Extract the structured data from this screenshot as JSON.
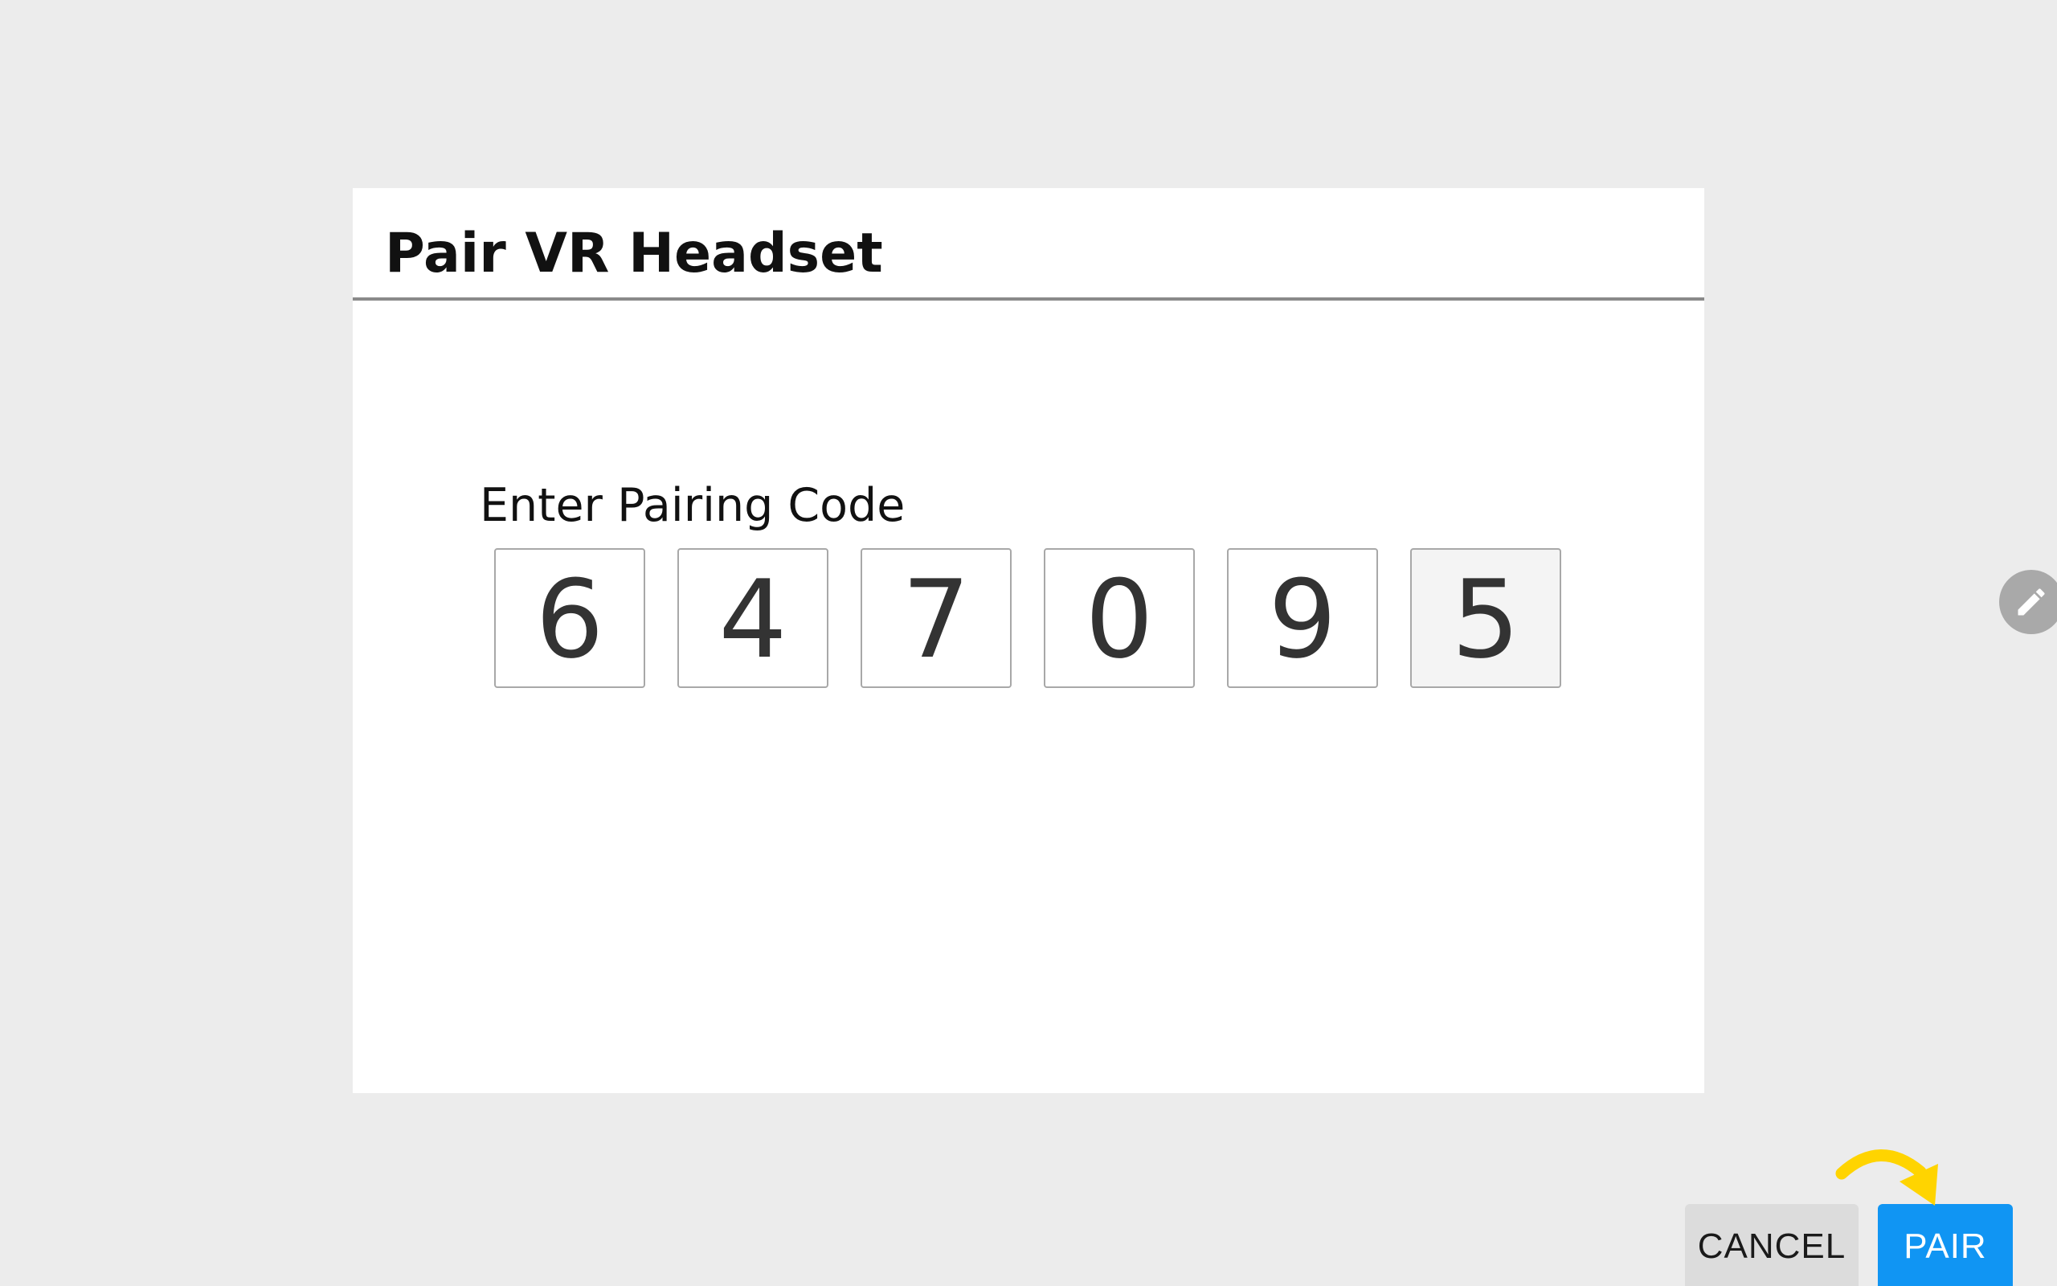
{
  "dialog": {
    "title": "Pair VR Headset",
    "label": "Enter Pairing Code",
    "code_digits": [
      "6",
      "4",
      "7",
      "0",
      "9",
      "5"
    ],
    "active_digit_index": 5
  },
  "buttons": {
    "cancel_label": "CANCEL",
    "pair_label": "PAIR"
  },
  "icons": {
    "edit": "pencil-icon",
    "hint": "curved-arrow-icon"
  },
  "colors": {
    "background": "#ececec",
    "dialog": "#ffffff",
    "primary": "#1095f3",
    "secondary_button": "#dcdcdc",
    "hint_arrow": "#ffd400",
    "fab": "#a9a9a9"
  }
}
